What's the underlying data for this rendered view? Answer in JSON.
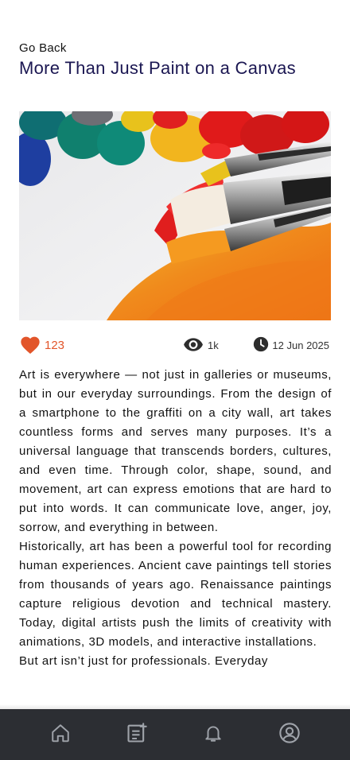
{
  "header": {
    "back_label": "Go Back",
    "title": "More Than Just Paint on a Canvas"
  },
  "hero": {
    "icon": "paintbrush-canvas-photo"
  },
  "meta": {
    "likes": "123",
    "views": "1k",
    "date": "12 Jun 2025",
    "like_color": "#e2552a"
  },
  "article": {
    "paragraphs": [
      "Art is everywhere — not just in galleries or museums, but in our everyday surroundings. From the design of a smartphone to the graffiti on a city wall, art takes countless forms and serves many purposes. It’s a universal language that transcends borders, cultures, and even time. Through color, shape, sound, and movement, art can express emotions that are hard to put into words. It can communicate love, anger, joy, sorrow, and everything in between.",
      "Historically, art has been a powerful tool for recording human experiences. Ancient cave paintings tell stories from thousands of years ago. Renaissance paintings capture religious devotion and technical mastery. Today, digital artists push the limits of creativity with animations, 3D models, and interactive installations.",
      "But art isn’t just for professionals. Everyday"
    ]
  },
  "navbar": {
    "items": [
      "home-icon",
      "article-icon",
      "bell-icon",
      "profile-icon"
    ],
    "background": "#2c2e33"
  }
}
